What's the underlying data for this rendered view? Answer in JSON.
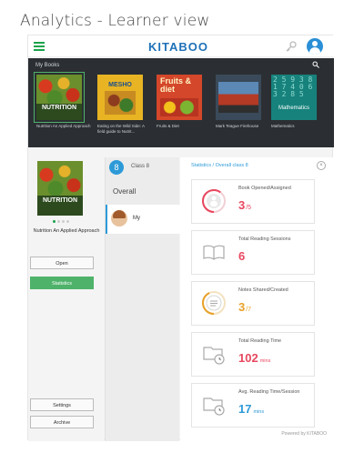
{
  "page_title": "Analytics - Learner view",
  "header": {
    "logo_text": "KITABOO",
    "icons": [
      "hamburger-menu-icon",
      "key-icon",
      "user-avatar-icon"
    ]
  },
  "shelf": {
    "title": "My Books",
    "books": [
      {
        "cover_text": "NUTRITION",
        "caption": "Nutrition An Applied Approach",
        "selected": true
      },
      {
        "cover_text": "MESHO",
        "caption": "Eating on the Wild Side: A field guide to Nutrit..."
      },
      {
        "cover_text": "Fruits & diet",
        "caption": "Fruits & Diet"
      },
      {
        "cover_text": "",
        "caption": "Mark Teague Firehouse"
      },
      {
        "cover_text": "Mathematics",
        "caption": "Mathematics"
      }
    ]
  },
  "left": {
    "cover_text": "NUTRITION",
    "book_name": "Nutrition An Applied Approach",
    "open_label": "Open",
    "statistics_label": "Statistics",
    "settings_label": "Settings",
    "archive_label": "Archive"
  },
  "mid": {
    "class_number": "8",
    "class_label": "Class 8",
    "overall_label": "Overall",
    "my_label": "My"
  },
  "right": {
    "breadcrumb": "Statistics / Overall class 8",
    "cards": [
      {
        "label": "Book Opened/Assigned",
        "value": "3",
        "sub": "/5",
        "unit": "",
        "color": "#e8475f",
        "fill": 0.6
      },
      {
        "label": "Total Reading Sessions",
        "value": "6",
        "sub": "",
        "unit": "",
        "color": "#e8475f"
      },
      {
        "label": "Notes Shared/Created",
        "value": "3",
        "sub": "/7",
        "unit": "",
        "color": "#e8a12a",
        "fill": 0.43
      },
      {
        "label": "Total Reading Time",
        "value": "102",
        "sub": "",
        "unit": "mins",
        "color": "#e8475f"
      },
      {
        "label": "Avg. Reading Time/Session",
        "value": "17",
        "sub": "",
        "unit": "mins",
        "color": "#2d9ad8"
      }
    ]
  },
  "footer": "Powered by KITABOO",
  "colors": {
    "accent_green": "#1aa34a",
    "brand_blue": "#1f72b8",
    "stat_red": "#e8475f",
    "stat_orange": "#e8a12a",
    "stat_blue": "#2d9ad8"
  }
}
